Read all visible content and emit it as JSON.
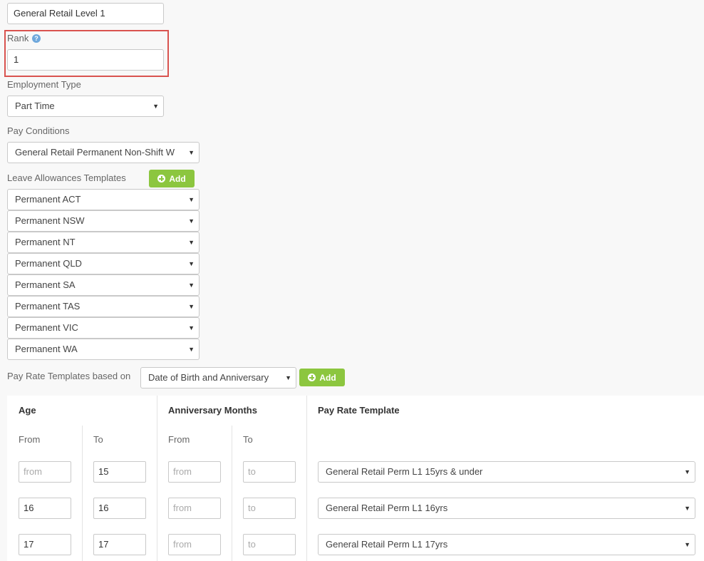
{
  "name_field": {
    "value": "General Retail Level 1"
  },
  "rank": {
    "label": "Rank",
    "value": "1"
  },
  "employment_type": {
    "label": "Employment Type",
    "value": "Part Time"
  },
  "pay_conditions": {
    "label": "Pay Conditions",
    "value": "General Retail Permanent Non-Shift W"
  },
  "leave": {
    "label": "Leave Allowances Templates",
    "add_label": "Add",
    "items": [
      "Permanent ACT",
      "Permanent NSW",
      "Permanent NT",
      "Permanent QLD",
      "Permanent SA",
      "Permanent TAS",
      "Permanent VIC",
      "Permanent WA"
    ]
  },
  "pay_rate": {
    "label": "Pay Rate Templates based on",
    "based_on": "Date of Birth and Anniversary",
    "add_label": "Add"
  },
  "table": {
    "age_header": "Age",
    "anniversary_header": "Anniversary Months",
    "template_header": "Pay Rate Template",
    "from_label": "From",
    "to_label": "To",
    "from_placeholder": "from",
    "to_placeholder": "to",
    "rows": [
      {
        "age_from": "",
        "age_to": "15",
        "ann_from": "",
        "ann_to": "",
        "template": "General Retail Perm L1 15yrs & under"
      },
      {
        "age_from": "16",
        "age_to": "16",
        "ann_from": "",
        "ann_to": "",
        "template": "General Retail Perm L1 16yrs"
      },
      {
        "age_from": "17",
        "age_to": "17",
        "ann_from": "",
        "ann_to": "",
        "template": "General Retail Perm L1 17yrs"
      }
    ]
  }
}
